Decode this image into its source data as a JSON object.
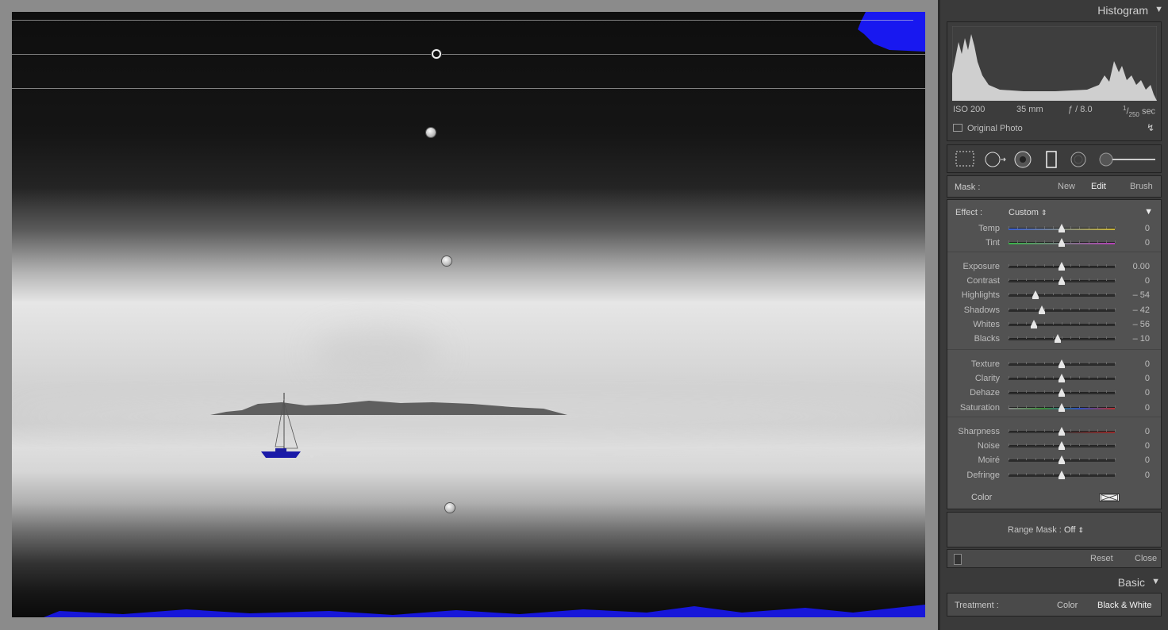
{
  "histogram": {
    "title": "Histogram",
    "exif": {
      "iso": "ISO 200",
      "focal": "35 mm",
      "aperture": "ƒ / 8.0",
      "shutter_num": "1",
      "shutter_den": "250",
      "shutter_unit": "sec"
    },
    "original_photo_label": "Original Photo"
  },
  "tools": {
    "icons": [
      "crop-overlay-icon",
      "spot-removal-icon",
      "red-eye-icon",
      "graduated-filter-icon",
      "radial-filter-icon",
      "adjustment-brush-icon"
    ],
    "selected": "graduated-filter-icon"
  },
  "mask": {
    "label": "Mask :",
    "tabs": [
      "New",
      "Edit",
      "Brush"
    ],
    "active": "Edit"
  },
  "effect": {
    "label": "Effect :",
    "value": "Custom",
    "groups": [
      [
        {
          "label": "Temp",
          "value": "0",
          "position": 0.5,
          "track": "temp"
        },
        {
          "label": "Tint",
          "value": "0",
          "position": 0.5,
          "track": "tint"
        }
      ],
      [
        {
          "label": "Exposure",
          "value": "0.00",
          "position": 0.5
        },
        {
          "label": "Contrast",
          "value": "0",
          "position": 0.5
        },
        {
          "label": "Highlights",
          "value": "– 54",
          "position": 0.25
        },
        {
          "label": "Shadows",
          "value": "– 42",
          "position": 0.31
        },
        {
          "label": "Whites",
          "value": "– 56",
          "position": 0.24
        },
        {
          "label": "Blacks",
          "value": "– 10",
          "position": 0.46
        }
      ],
      [
        {
          "label": "Texture",
          "value": "0",
          "position": 0.5
        },
        {
          "label": "Clarity",
          "value": "0",
          "position": 0.5
        },
        {
          "label": "Dehaze",
          "value": "0",
          "position": 0.5
        },
        {
          "label": "Saturation",
          "value": "0",
          "position": 0.5,
          "track": "saturation"
        }
      ],
      [
        {
          "label": "Sharpness",
          "value": "0",
          "position": 0.5,
          "track": "sharpness"
        },
        {
          "label": "Noise",
          "value": "0",
          "position": 0.5
        },
        {
          "label": "Moiré",
          "value": "0",
          "position": 0.5
        },
        {
          "label": "Defringe",
          "value": "0",
          "position": 0.5
        }
      ]
    ],
    "color_label": "Color"
  },
  "range_mask": {
    "label": "Range Mask :",
    "value": "Off"
  },
  "footer": {
    "reset": "Reset",
    "close": "Close"
  },
  "basic": {
    "title": "Basic",
    "treatment_label": "Treatment :",
    "options": [
      "Color",
      "Black & White"
    ],
    "active": "Black & White"
  },
  "colors": {
    "clip_blue": "#1818f0",
    "panel_bg": "#3a3a3a",
    "section_bg": "#525252"
  }
}
